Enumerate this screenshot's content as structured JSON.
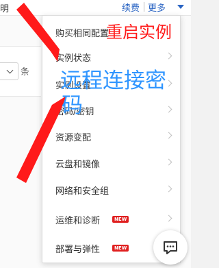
{
  "header": {
    "edge_label": "明",
    "renew_label": "续费",
    "more_label": "更多"
  },
  "toolbar": {
    "unit_label": "条"
  },
  "menu": {
    "items": [
      {
        "label": "购买相同配置"
      },
      {
        "label": "实例状态"
      },
      {
        "label": "实例设置"
      },
      {
        "label": "密码/密钥"
      },
      {
        "label": "资源变配"
      },
      {
        "label": "云盘和镜像"
      },
      {
        "label": "网络和安全组"
      },
      {
        "label": "运维和诊断",
        "badge": "NEW"
      },
      {
        "label": "部署与弹性",
        "badge": "NEW"
      }
    ]
  },
  "annotations": {
    "restart_text": "重启实例",
    "remote_line1": "远程连接密",
    "remote_line2": "码"
  },
  "colors": {
    "annotation_red": "#ff1a1a",
    "annotation_blue": "#2f95ff",
    "link_blue": "#2a64c3",
    "badge_red": "#e02020"
  },
  "icons": {
    "chat": "chat-bubble-icon",
    "chevron": "chevron-right-icon"
  }
}
